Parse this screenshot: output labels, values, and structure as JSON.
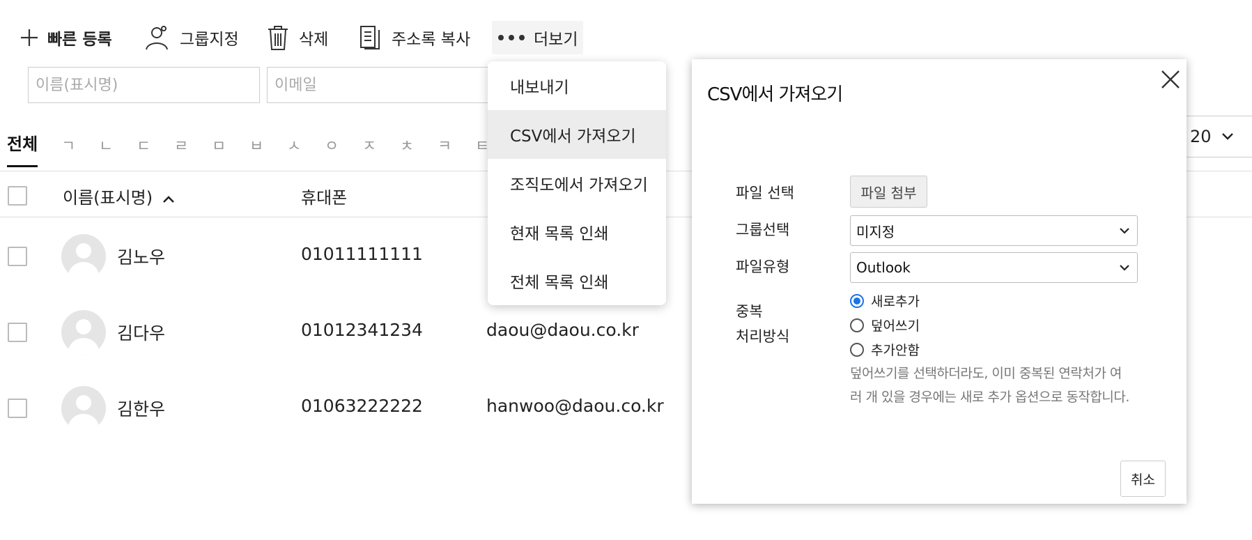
{
  "toolbar": {
    "quick_add": "빠른 등록",
    "group_assign": "그룹지정",
    "delete": "삭제",
    "copy_addressbook": "주소록 복사",
    "more": "더보기"
  },
  "search": {
    "name_placeholder": "이름(표시명)",
    "email_placeholder": "이메일"
  },
  "filter": {
    "all": "전체",
    "consonants": [
      "ㄱ",
      "ㄴ",
      "ㄷ",
      "ㄹ",
      "ㅁ",
      "ㅂ",
      "ㅅ",
      "ㅇ",
      "ㅈ",
      "ㅊ",
      "ㅋ",
      "ㅌ"
    ],
    "page_size": "20"
  },
  "table": {
    "columns": {
      "name": "이름(표시명)",
      "mobile": "휴대폰"
    },
    "rows": [
      {
        "name": "김노우",
        "mobile": "01011111111",
        "email": ""
      },
      {
        "name": "김다우",
        "mobile": "01012341234",
        "email": "daou@daou.co.kr"
      },
      {
        "name": "김한우",
        "mobile": "01063222222",
        "email": "hanwoo@daou.co.kr"
      }
    ]
  },
  "more_menu": {
    "items": [
      "내보내기",
      "CSV에서 가져오기",
      "조직도에서 가져오기",
      "현재 목록 인쇄",
      "전체 목록 인쇄"
    ],
    "active_index": 1
  },
  "dialog": {
    "title": "CSV에서 가져오기",
    "file_select_label": "파일 선택",
    "file_attach_button": "파일 첨부",
    "group_label": "그룹선택",
    "group_value": "미지정",
    "filetype_label": "파일유형",
    "filetype_value": "Outlook",
    "duplicate_label_1": "중복",
    "duplicate_label_2": "처리방식",
    "options": [
      "새로추가",
      "덮어쓰기",
      "추가안함"
    ],
    "selected_option": 0,
    "hint_line_1": "덮어쓰기를 선택하더라도, 이미 중복된 연락처가 여",
    "hint_line_2": "러 개 있을 경우에는 새로 추가 옵션으로 동작합니다.",
    "cancel_button": "취소"
  },
  "colors": {
    "accent": "#1a73e8",
    "menu_active_bg": "#ececec"
  }
}
